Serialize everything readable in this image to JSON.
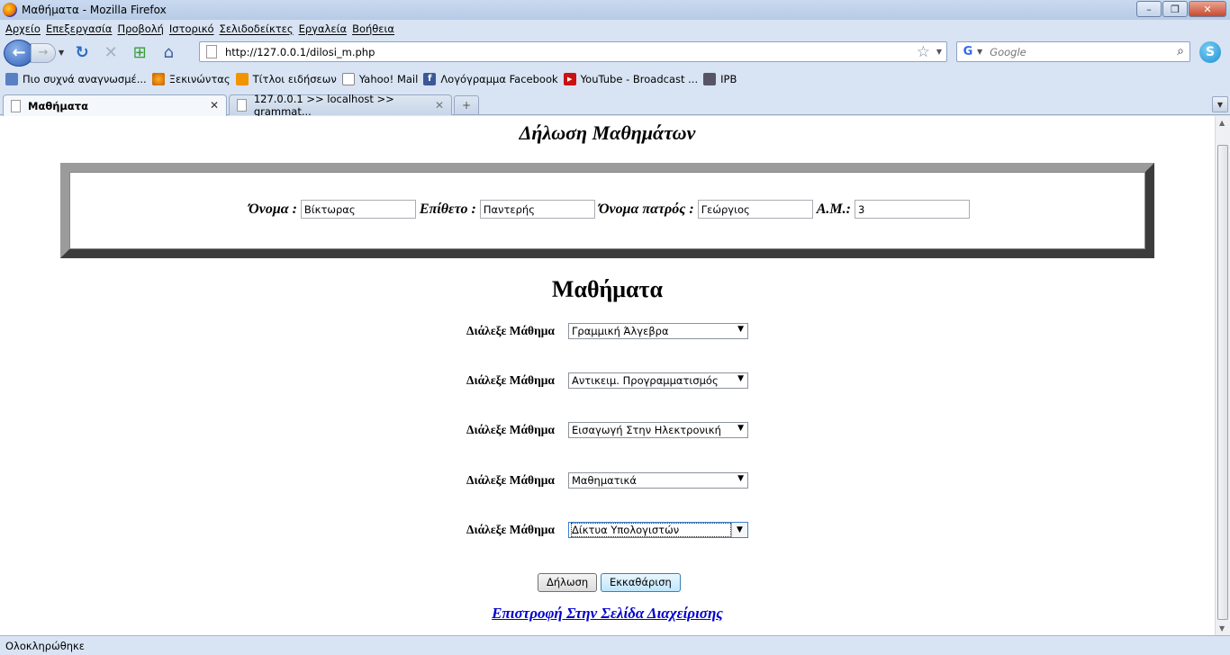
{
  "window": {
    "title": "Μαθήματα - Mozilla Firefox"
  },
  "menu": [
    "Αρχείο",
    "Επεξεργασία",
    "Προβολή",
    "Ιστορικό",
    "Σελιδοδείκτες",
    "Εργαλεία",
    "Βοήθεια"
  ],
  "navbar": {
    "url": "http://127.0.0.1/dilosi_m.php",
    "search_placeholder": "Google"
  },
  "bookmarks": [
    {
      "label": "Πιο συχνά αναγνωσμέ...",
      "icon": "bar-chart-icon"
    },
    {
      "label": "Ξεκινώντας",
      "icon": "firefox-icon"
    },
    {
      "label": "Τίτλοι ειδήσεων",
      "icon": "rss-icon"
    },
    {
      "label": "Yahoo! Mail",
      "icon": "page-icon"
    },
    {
      "label": "Λογόγραμμα Facebook",
      "icon": "facebook-icon"
    },
    {
      "label": "YouTube - Broadcast ...",
      "icon": "youtube-icon"
    },
    {
      "label": "IPB",
      "icon": "ipb-icon"
    }
  ],
  "tabs": [
    {
      "label": "Μαθήματα",
      "active": true
    },
    {
      "label": "127.0.0.1 >> localhost >> grammat...",
      "active": false
    }
  ],
  "page": {
    "title": "Δήλωση Μαθημάτων",
    "student": {
      "first_name_label": "Όνομα :",
      "first_name": "Βίκτωρας",
      "last_name_label": "Επίθετο :",
      "last_name": "Παντερής",
      "father_label": "Όνομα πατρός :",
      "father_name": "Γεώργιος",
      "am_label": "Α.Μ.:",
      "am": "3"
    },
    "section_title": "Μαθήματα",
    "course_label": "Διάλεξε Μάθημα",
    "courses": [
      "Γραμμική Άλγεβρα",
      "Αντικειμ. Προγραμματισμός",
      "Εισαγωγή Στην Ηλεκτρονική",
      "Μαθηματικά",
      "Δίκτυα Υπολογιστών"
    ],
    "submit_label": "Δήλωση",
    "reset_label": "Εκκαθάριση",
    "back_link": "Επιστροφή Στην Σελίδα Διαχείρισης"
  },
  "status": "Ολοκληρώθηκε",
  "colors": {
    "link": "#0000cc",
    "reset_button": "#bee6fd"
  }
}
